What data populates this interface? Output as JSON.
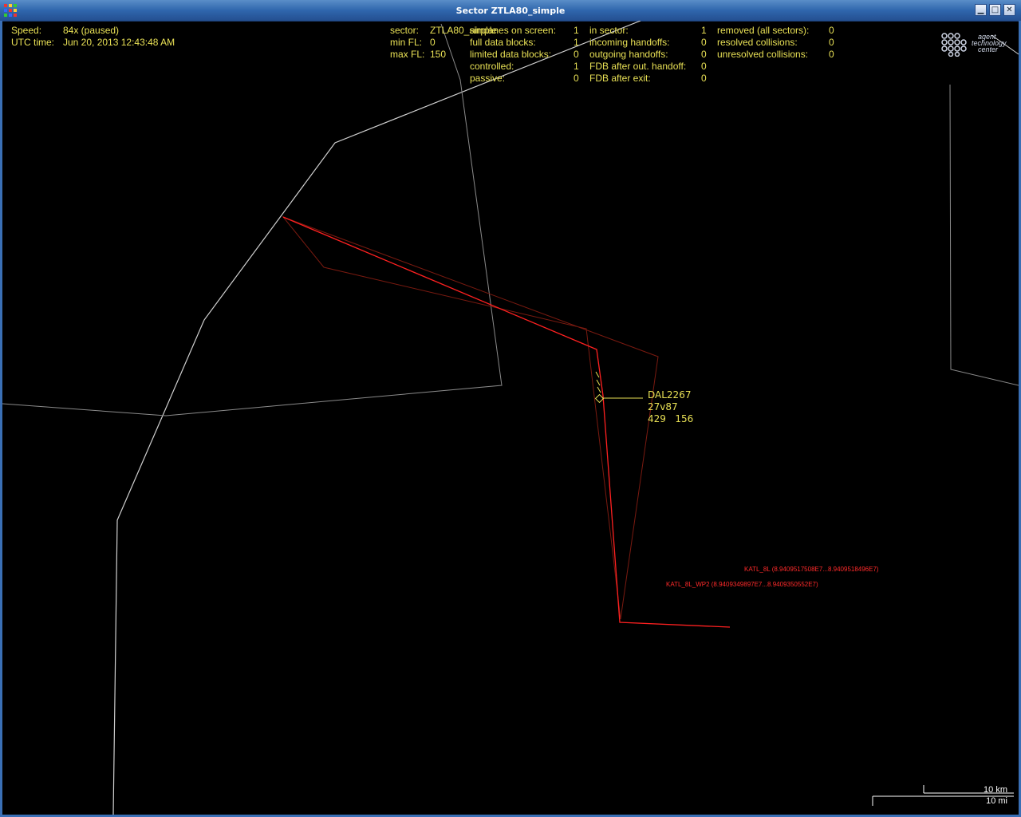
{
  "window": {
    "title": "Sector ZTLA80_simple",
    "buttons": [
      "minimize",
      "maximize",
      "close"
    ]
  },
  "status": {
    "speed_label": "Speed:",
    "speed_value": "84x (paused)",
    "utc_label": "UTC time:",
    "utc_value": "Jun 20, 2013 12:43:48 AM"
  },
  "sector_info": {
    "sector_label": "sector:",
    "sector_value": "ZTLA80_simple",
    "min_fl_label": "min FL:",
    "min_fl_value": "0",
    "max_fl_label": "max FL:",
    "max_fl_value": "150"
  },
  "stats_col1": [
    {
      "label": "airplanes on screen:",
      "value": "1"
    },
    {
      "label": "full data blocks:",
      "value": "1"
    },
    {
      "label": "limited data blocks:",
      "value": "0"
    },
    {
      "label": "controlled:",
      "value": "1"
    },
    {
      "label": "passive:",
      "value": "0"
    }
  ],
  "stats_col2": [
    {
      "label": "in sector:",
      "value": "1"
    },
    {
      "label": "incoming handoffs:",
      "value": "0"
    },
    {
      "label": "outgoing handoffs:",
      "value": "0"
    },
    {
      "label": "FDB after out. handoff:",
      "value": "0"
    },
    {
      "label": "FDB after exit:",
      "value": "0"
    }
  ],
  "stats_col3": [
    {
      "label": "removed (all sectors):",
      "value": "0"
    },
    {
      "label": "resolved collisions:",
      "value": "0"
    },
    {
      "label": "unresolved collisions:",
      "value": "0"
    }
  ],
  "logo": {
    "line1": "agent",
    "line2": "technology",
    "line3": "center"
  },
  "aircraft": {
    "callsign": "DAL2267",
    "line2": "27v87",
    "speed": "429",
    "heading": "156"
  },
  "waypoints": [
    {
      "label": "KATL_8L (8.9409517508E7...8.9409518496E7)"
    },
    {
      "label": "KATL_8L_WP2 (8.9409349897E7...8.9409350552E7)"
    }
  ],
  "scale": {
    "km": "10 km",
    "mi": "10 mi"
  },
  "colors": {
    "hud_text": "#e8e055",
    "route": "#ff2020",
    "route_dim": "#7a1a10",
    "sector_boundary": "#c8c8c8",
    "background": "#000000"
  }
}
